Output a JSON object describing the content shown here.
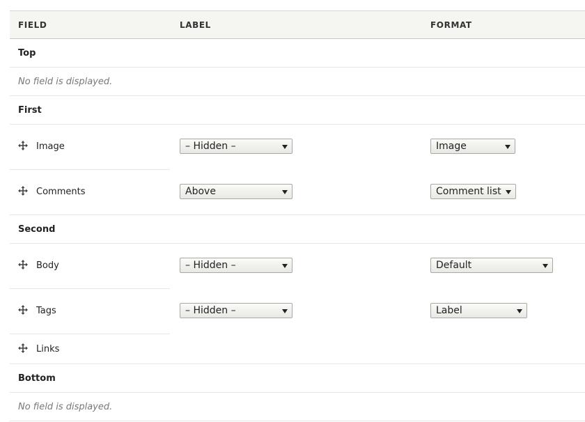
{
  "headers": {
    "field": "FIELD",
    "label": "LABEL",
    "format": "FORMAT"
  },
  "regions": {
    "top": {
      "name": "Top",
      "empty": "No field is displayed."
    },
    "first": {
      "name": "First"
    },
    "second": {
      "name": "Second"
    },
    "bottom": {
      "name": "Bottom",
      "empty": "No field is displayed."
    }
  },
  "fields": {
    "image": {
      "name": "Image",
      "label": "– Hidden –",
      "format": "Image"
    },
    "comments": {
      "name": "Comments",
      "label": "Above",
      "format": "Comment list"
    },
    "body": {
      "name": "Body",
      "label": "– Hidden –",
      "format": "Default"
    },
    "tags": {
      "name": "Tags",
      "label": "– Hidden –",
      "format": "Label"
    },
    "links": {
      "name": "Links"
    }
  },
  "icons": {
    "drag": "drag-handle-icon",
    "dropdown": "chevron-down-icon"
  }
}
